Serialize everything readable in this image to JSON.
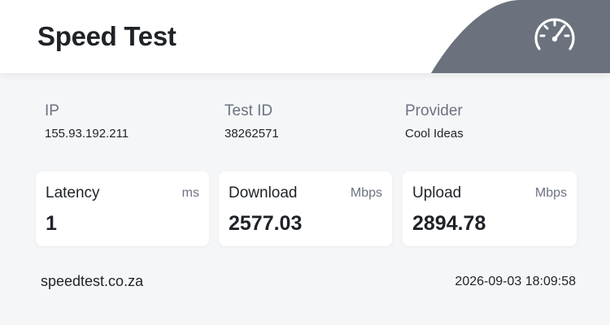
{
  "header": {
    "title": "Speed Test",
    "accent_color": "#6b727d",
    "icon": "speedometer-icon"
  },
  "info": {
    "ip": {
      "label": "IP",
      "value": "155.93.192.211"
    },
    "test_id": {
      "label": "Test ID",
      "value": "38262571"
    },
    "provider": {
      "label": "Provider",
      "value": "Cool Ideas"
    }
  },
  "metrics": {
    "latency": {
      "label": "Latency",
      "unit": "ms",
      "value": "1"
    },
    "download": {
      "label": "Download",
      "unit": "Mbps",
      "value": "2577.03"
    },
    "upload": {
      "label": "Upload",
      "unit": "Mbps",
      "value": "2894.78"
    }
  },
  "footer": {
    "site": "speedtest.co.za",
    "timestamp": "2026-09-03 18:09:58"
  }
}
